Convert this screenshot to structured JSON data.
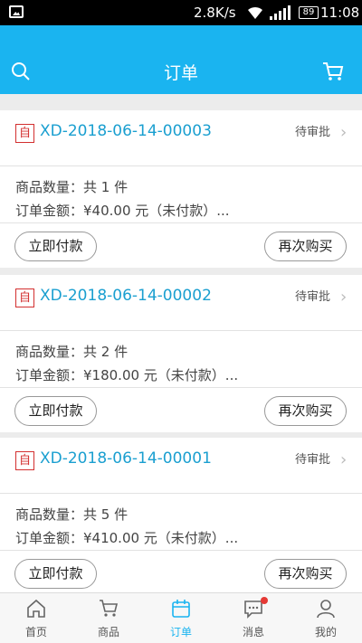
{
  "status_bar": {
    "speed": "2.8K/s",
    "battery": "89",
    "time": "11:08"
  },
  "navbar": {
    "title": "订单"
  },
  "orders": [
    {
      "tag": "自",
      "order_no": "XD-2018-06-14-00003",
      "status": "待审批",
      "quantity_text": "商品数量：共 1 件",
      "amount_text": "订单金额：¥40.00 元（未付款）...",
      "pay_label": "立即付款",
      "again_label": "再次购买"
    },
    {
      "tag": "自",
      "order_no": "XD-2018-06-14-00002",
      "status": "待审批",
      "quantity_text": "商品数量：共 2 件",
      "amount_text": "订单金额：¥180.00 元（未付款）...",
      "pay_label": "立即付款",
      "again_label": "再次购买"
    },
    {
      "tag": "自",
      "order_no": "XD-2018-06-14-00001",
      "status": "待审批",
      "quantity_text": "商品数量：共 5 件",
      "amount_text": "订单金额：¥410.00 元（未付款）...",
      "pay_label": "立即付款",
      "again_label": "再次购买"
    }
  ],
  "tabbar": {
    "active_color": "#1ab4f0",
    "items": [
      {
        "label": "首页",
        "icon": "home-icon"
      },
      {
        "label": "商品",
        "icon": "cart-icon"
      },
      {
        "label": "订单",
        "icon": "orders-icon"
      },
      {
        "label": "消息",
        "icon": "message-icon"
      },
      {
        "label": "我的",
        "icon": "user-icon"
      }
    ]
  },
  "colors": {
    "brand": "#1ab4f0",
    "order_no": "#1a9fd0",
    "tag": "#d32f2f",
    "badge": "#e53935"
  }
}
